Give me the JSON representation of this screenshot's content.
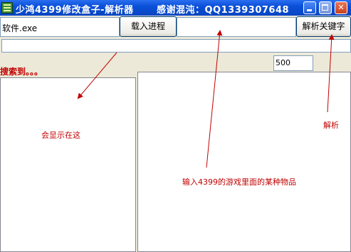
{
  "window": {
    "title": "少鸿4399修改盒子-解析器",
    "thanks": "感谢混沌：QQ1339307648"
  },
  "toolbar": {
    "process_value": "软件.exe",
    "load_label": "载入进程",
    "keyword_value": "",
    "parse_label": "解析关键字"
  },
  "status": {
    "searching": "搜索到。。。",
    "count_value": "500"
  },
  "annotations": {
    "display_here": "会显示在这",
    "parse": "解析",
    "input_hint": "输入4399的游戏里面的某种物品"
  },
  "colors": {
    "annotation": "#C00000",
    "titlebar": "#0A4FD8",
    "face": "#ECE9D8"
  }
}
